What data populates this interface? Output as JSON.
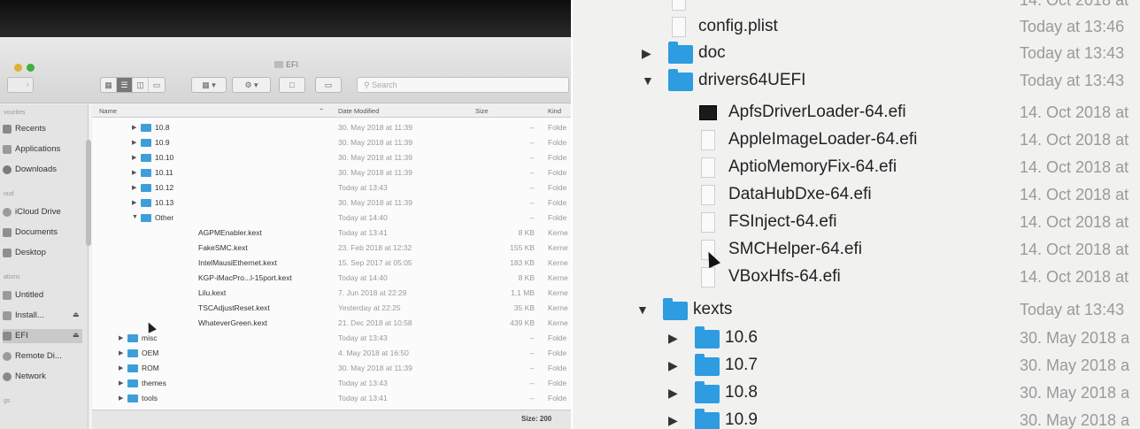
{
  "window": {
    "title": "EFI",
    "search_placeholder": "Search"
  },
  "sidebar": {
    "favorites_head": "vourites",
    "icloud_head": "oud",
    "locations_head": "ations",
    "tags_head": "gs",
    "items": {
      "recents": "Recents",
      "applications": "Applications",
      "downloads": "Downloads",
      "icloud_drive": "iCloud Drive",
      "documents": "Documents",
      "desktop": "Desktop",
      "untitled": "Untitled",
      "install": "Install...",
      "efi": "EFI",
      "remote_disc": "Remote Di...",
      "network": "Network"
    }
  },
  "columns": {
    "name": "Name",
    "date": "Date Modified",
    "size": "Size",
    "kind": "Kind"
  },
  "rows": [
    {
      "name": "10.8",
      "date": "30. May 2018 at 11:39",
      "size": "--",
      "kind": "Folde"
    },
    {
      "name": "10.9",
      "date": "30. May 2018 at 11:39",
      "size": "--",
      "kind": "Folde"
    },
    {
      "name": "10.10",
      "date": "30. May 2018 at 11:39",
      "size": "--",
      "kind": "Folde"
    },
    {
      "name": "10.11",
      "date": "30. May 2018 at 11:39",
      "size": "--",
      "kind": "Folde"
    },
    {
      "name": "10.12",
      "date": "Today at 13:43",
      "size": "--",
      "kind": "Folde"
    },
    {
      "name": "10.13",
      "date": "30. May 2018 at 11:39",
      "size": "--",
      "kind": "Folde"
    },
    {
      "name": "Other",
      "date": "Today at 14:40",
      "size": "--",
      "kind": "Folde"
    },
    {
      "name": "AGPMEnabler.kext",
      "date": "Today at 13:41",
      "size": "8 KB",
      "kind": "Kerne"
    },
    {
      "name": "FakeSMC.kext",
      "date": "23. Feb 2018 at 12:32",
      "size": "155 KB",
      "kind": "Kerne"
    },
    {
      "name": "IntelMausiEthernet.kext",
      "date": "15. Sep 2017 at 05:05",
      "size": "183 KB",
      "kind": "Kerne"
    },
    {
      "name": "KGP-iMacPro...l-15port.kext",
      "date": "Today at 14:40",
      "size": "8 KB",
      "kind": "Kerne"
    },
    {
      "name": "Lilu.kext",
      "date": "7. Jun 2018 at 22:29",
      "size": "1,1 MB",
      "kind": "Kerne"
    },
    {
      "name": "TSCAdjustReset.kext",
      "date": "Yesterday at 22:25",
      "size": "35 KB",
      "kind": "Kerne"
    },
    {
      "name": "WhateverGreen.kext",
      "date": "21. Dec 2018 at 10:58",
      "size": "439 KB",
      "kind": "Kerne"
    },
    {
      "name": "misc",
      "date": "Today at 13:43",
      "size": "--",
      "kind": "Folde"
    },
    {
      "name": "OEM",
      "date": "4. May 2018 at 16:50",
      "size": "--",
      "kind": "Folde"
    },
    {
      "name": "ROM",
      "date": "30. May 2018 at 11:39",
      "size": "--",
      "kind": "Folde"
    },
    {
      "name": "themes",
      "date": "Today at 13:43",
      "size": "--",
      "kind": "Folde"
    },
    {
      "name": "tools",
      "date": "Today at 13:41",
      "size": "--",
      "kind": "Folde"
    }
  ],
  "status": {
    "capacity": "Size: 200"
  },
  "zoom_rows": [
    {
      "name": "config.plist",
      "date": "Today at 13:46"
    },
    {
      "name": "doc",
      "date": "Today at 13:43"
    },
    {
      "name": "drivers64UEFI",
      "date": "Today at 13:43"
    },
    {
      "name": "ApfsDriverLoader-64.efi",
      "date": "14. Oct 2018 at"
    },
    {
      "name": "AppleImageLoader-64.efi",
      "date": "14. Oct 2018 at"
    },
    {
      "name": "AptioMemoryFix-64.efi",
      "date": "14. Oct 2018 at"
    },
    {
      "name": "DataHubDxe-64.efi",
      "date": "14. Oct 2018 at"
    },
    {
      "name": "FSInject-64.efi",
      "date": "14. Oct 2018 at"
    },
    {
      "name": "SMCHelper-64.efi",
      "date": "14. Oct 2018 at"
    },
    {
      "name": "VBoxHfs-64.efi",
      "date": "14. Oct 2018 at"
    },
    {
      "name": "kexts",
      "date": "Today at 13:43"
    },
    {
      "name": "10.6",
      "date": "30. May 2018 a"
    },
    {
      "name": "10.7",
      "date": "30. May 2018 a"
    },
    {
      "name": "10.8",
      "date": "30. May 2018 a"
    },
    {
      "name": "10.9",
      "date": "30. May 2018 a"
    }
  ],
  "zoom_top_date": "14. Oct 2018 at",
  "colors": {
    "folder": "#2d9ce0",
    "selection": "#c9c9c9"
  },
  "icons": [
    "folder-icon",
    "file-icon",
    "disclosure-triangle-icon",
    "search-icon",
    "gear-icon",
    "eject-icon",
    "pointer-cursor-icon"
  ]
}
